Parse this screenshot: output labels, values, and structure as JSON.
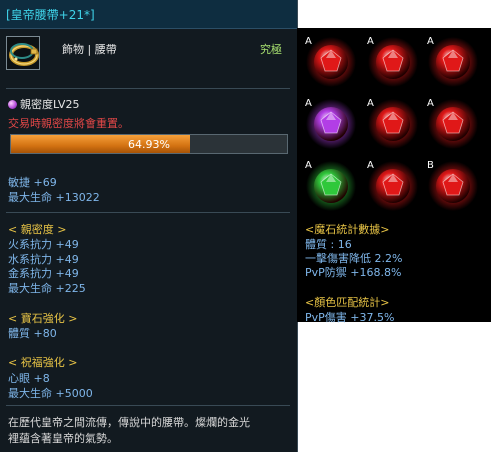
{
  "tooltip": {
    "title": "[皇帝腰帶+21*]",
    "icon": "golden-belt-icon",
    "category": "飾物 | 腰帶",
    "rarity": "究極",
    "rarity_color": "#a7e06f",
    "affinity_level": "親密度LV25",
    "warning": "交易時親密度將會重置。",
    "progress_value": 64.93,
    "progress_label": "64.93%",
    "base_stats": [
      "敏捷 +69",
      "最大生命 +13022"
    ],
    "affinity_header": "< 親密度 >",
    "affinity_stats": [
      "火系抗力 +49",
      "水系抗力 +49",
      "金系抗力 +49",
      "最大生命 +225"
    ],
    "gem_enhance_header": "< 寶石強化 >",
    "gem_enhance_stats": [
      "體質 +80"
    ],
    "bless_header": "< 祝福強化 >",
    "bless_stats": [
      "心眼 +8",
      "最大生命 +5000"
    ],
    "description_lines": [
      "在歷代皇帝之間流傳，傳說中的腰帶。燦爛的金光",
      "裡蘊含著皇帝的氣勢。"
    ]
  },
  "gems_panel": {
    "gems": [
      {
        "grade": "A",
        "color": "red"
      },
      {
        "grade": "A",
        "color": "red"
      },
      {
        "grade": "A",
        "color": "red"
      },
      {
        "grade": "A",
        "color": "purple"
      },
      {
        "grade": "A",
        "color": "red"
      },
      {
        "grade": "A",
        "color": "red"
      },
      {
        "grade": "A",
        "color": "green"
      },
      {
        "grade": "A",
        "color": "red"
      },
      {
        "grade": "B",
        "color": "red"
      }
    ],
    "gem_colors": {
      "red": "#e01818",
      "purple": "#b23ee6",
      "green": "#2fc83b"
    },
    "gem_stats_header": "<魔石統計數據>",
    "gem_stats": [
      "體質 : 16",
      "一擊傷害降低 2.2%",
      "PvP防禦 +168.8%"
    ],
    "color_match_header": "<顏色匹配統計>",
    "color_match_stats": [
      "PvP傷害 +37.5%"
    ]
  }
}
